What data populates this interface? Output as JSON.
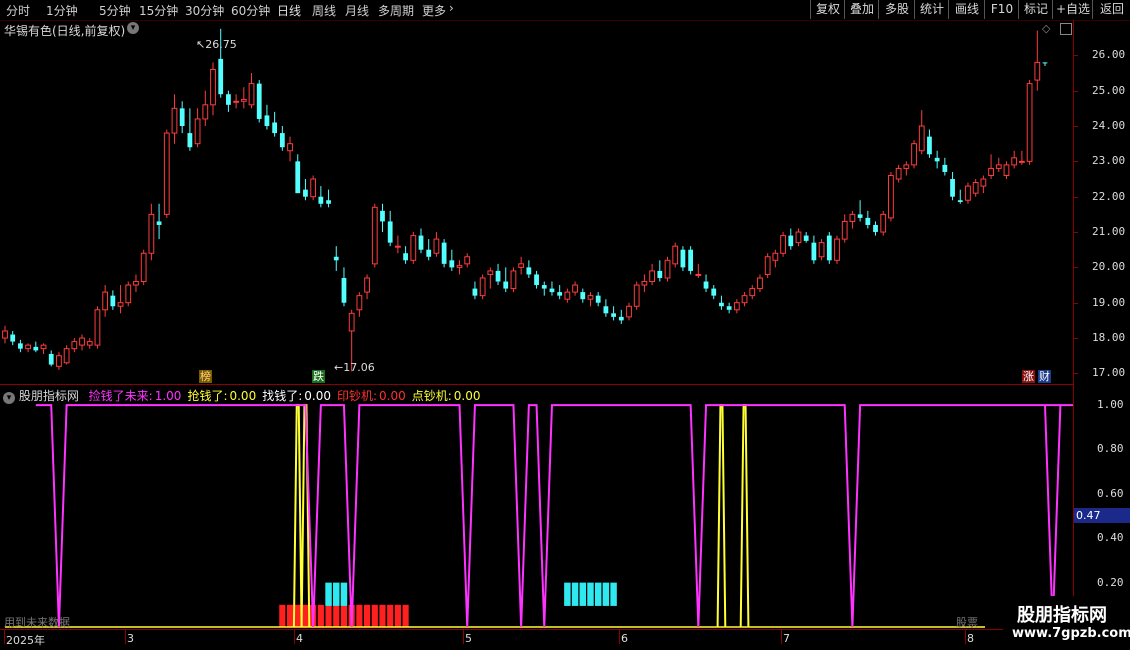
{
  "toolbar": {
    "periods": [
      "分时",
      "1分钟",
      "5分钟",
      "15分钟",
      "30分钟",
      "60分钟",
      "日线",
      "周线",
      "月线",
      "多周期",
      "更多"
    ],
    "more_icon": "chevron-right-icon",
    "right_tabs": [
      "复权",
      "叠加",
      "多股",
      "统计",
      "画线",
      "F10",
      "标记",
      "+自选",
      "返回"
    ]
  },
  "stock_title": "华锡有色(日线,前复权)",
  "stock_title_icon": "chevron-down-circle-icon",
  "price_annotations": {
    "high": "26.75",
    "low": "17.06"
  },
  "price_axis": [
    "26.00",
    "25.00",
    "24.00",
    "23.00",
    "22.00",
    "21.00",
    "20.00",
    "19.00",
    "18.00",
    "17.00"
  ],
  "top_badges": {
    "bang": "榜",
    "die": "跌",
    "zhang": "涨",
    "cai": "财"
  },
  "indicator": {
    "name": "股朋指标网",
    "items": [
      {
        "label": "捡钱了未来:",
        "value": "1.00",
        "color": "#ff33ff"
      },
      {
        "label": "抢钱了:",
        "value": "0.00",
        "color": "#ffff33"
      },
      {
        "label": "找钱了:",
        "value": "0.00",
        "color": "#ffffff"
      },
      {
        "label": "印钞机:",
        "value": "0.00",
        "color": "#ff3030"
      },
      {
        "label": "点钞机:",
        "value": "0.00",
        "color": "#ffff33"
      }
    ],
    "axis": [
      "1.00",
      "0.80",
      "0.60",
      "0.40",
      "0.20"
    ],
    "current": "0.47",
    "bottom_left_note": "用到未来数据",
    "bottom_right_note": "股票"
  },
  "x_axis": [
    "2025年",
    "3",
    "4",
    "5",
    "6",
    "7",
    "8"
  ],
  "watermark": {
    "title": "股朋指标网",
    "url": "www.7gpzb.com"
  },
  "colors": {
    "up": "#ff3c3c",
    "down": "#54ffff",
    "grid": "#8b0000",
    "magenta": "#ff33ff",
    "yellow": "#ffff33"
  },
  "chart_data": [
    {
      "type": "candlestick",
      "title": "华锡有色(日线,前复权)",
      "ylim": [
        16.7,
        27.0
      ],
      "max_label": 26.75,
      "min_label": 17.06,
      "ohlc": [
        [
          18.0,
          18.35,
          17.85,
          18.2
        ],
        [
          18.1,
          18.2,
          17.8,
          17.9
        ],
        [
          17.85,
          17.95,
          17.6,
          17.7
        ],
        [
          17.7,
          17.85,
          17.6,
          17.8
        ],
        [
          17.75,
          17.9,
          17.6,
          17.65
        ],
        [
          17.7,
          17.85,
          17.55,
          17.8
        ],
        [
          17.55,
          17.65,
          17.2,
          17.25
        ],
        [
          17.2,
          17.6,
          17.1,
          17.5
        ],
        [
          17.3,
          17.8,
          17.25,
          17.7
        ],
        [
          17.7,
          18.0,
          17.6,
          17.9
        ],
        [
          17.8,
          18.1,
          17.65,
          18.0
        ],
        [
          17.8,
          18.0,
          17.7,
          17.9
        ],
        [
          17.8,
          18.9,
          17.7,
          18.8
        ],
        [
          18.8,
          19.5,
          18.6,
          19.3
        ],
        [
          19.2,
          19.35,
          18.8,
          18.9
        ],
        [
          18.9,
          19.5,
          18.7,
          19.0
        ],
        [
          19.0,
          19.6,
          18.9,
          19.5
        ],
        [
          19.5,
          19.8,
          19.3,
          19.6
        ],
        [
          19.6,
          20.5,
          19.5,
          20.4
        ],
        [
          20.4,
          21.8,
          20.2,
          21.5
        ],
        [
          21.3,
          21.8,
          20.8,
          21.2
        ],
        [
          21.5,
          23.9,
          21.4,
          23.8
        ],
        [
          23.8,
          24.9,
          23.5,
          24.5
        ],
        [
          24.5,
          24.7,
          23.8,
          24.0
        ],
        [
          23.8,
          24.5,
          23.3,
          23.4
        ],
        [
          23.5,
          24.5,
          23.4,
          24.2
        ],
        [
          24.2,
          25.0,
          24.0,
          24.6
        ],
        [
          24.6,
          25.8,
          24.3,
          25.6
        ],
        [
          25.9,
          26.75,
          24.8,
          24.9
        ],
        [
          24.9,
          25.0,
          24.4,
          24.6
        ],
        [
          24.7,
          24.9,
          24.5,
          24.7
        ],
        [
          24.7,
          25.1,
          24.5,
          24.75
        ],
        [
          24.6,
          25.5,
          24.5,
          25.2
        ],
        [
          25.2,
          25.3,
          24.1,
          24.2
        ],
        [
          24.3,
          24.6,
          23.9,
          24.0
        ],
        [
          24.1,
          24.4,
          23.7,
          23.8
        ],
        [
          23.8,
          24.0,
          23.3,
          23.4
        ],
        [
          23.3,
          23.7,
          23.0,
          23.5
        ],
        [
          23.0,
          23.2,
          22.1,
          22.1
        ],
        [
          22.2,
          22.5,
          21.9,
          22.0
        ],
        [
          22.0,
          22.6,
          21.9,
          22.5
        ],
        [
          22.0,
          22.3,
          21.7,
          21.8
        ],
        [
          21.9,
          22.2,
          21.7,
          21.8
        ],
        [
          20.3,
          20.6,
          19.9,
          20.2
        ],
        [
          19.7,
          20.0,
          18.9,
          19.0
        ],
        [
          18.2,
          18.8,
          17.06,
          18.7
        ],
        [
          18.8,
          19.3,
          18.6,
          19.2
        ],
        [
          19.3,
          19.8,
          19.1,
          19.7
        ],
        [
          20.1,
          21.8,
          20.0,
          21.7
        ],
        [
          21.6,
          21.8,
          21.0,
          21.3
        ],
        [
          21.3,
          21.6,
          20.6,
          20.7
        ],
        [
          20.6,
          20.9,
          20.4,
          20.6
        ],
        [
          20.4,
          20.6,
          20.1,
          20.2
        ],
        [
          20.2,
          21.0,
          20.1,
          20.9
        ],
        [
          20.9,
          21.1,
          20.4,
          20.5
        ],
        [
          20.5,
          20.8,
          20.2,
          20.3
        ],
        [
          20.4,
          21.0,
          20.3,
          20.8
        ],
        [
          20.7,
          20.8,
          20.0,
          20.1
        ],
        [
          20.2,
          20.5,
          19.9,
          20.0
        ],
        [
          20.0,
          20.2,
          19.8,
          20.05
        ],
        [
          20.1,
          20.4,
          20.0,
          20.3
        ],
        [
          19.4,
          19.6,
          19.1,
          19.2
        ],
        [
          19.2,
          19.8,
          19.1,
          19.7
        ],
        [
          19.8,
          20.0,
          19.4,
          19.9
        ],
        [
          19.9,
          20.1,
          19.5,
          19.6
        ],
        [
          19.6,
          20.0,
          19.3,
          19.4
        ],
        [
          19.4,
          20.0,
          19.3,
          19.9
        ],
        [
          20.0,
          20.3,
          19.8,
          20.1
        ],
        [
          20.0,
          20.2,
          19.7,
          19.8
        ],
        [
          19.8,
          19.9,
          19.4,
          19.5
        ],
        [
          19.5,
          19.6,
          19.2,
          19.4
        ],
        [
          19.4,
          19.6,
          19.2,
          19.3
        ],
        [
          19.3,
          19.5,
          19.1,
          19.2
        ],
        [
          19.1,
          19.4,
          19.0,
          19.3
        ],
        [
          19.3,
          19.6,
          19.2,
          19.5
        ],
        [
          19.3,
          19.4,
          19.0,
          19.1
        ],
        [
          19.1,
          19.3,
          18.9,
          19.2
        ],
        [
          19.2,
          19.3,
          18.9,
          19.0
        ],
        [
          18.9,
          19.1,
          18.6,
          18.7
        ],
        [
          18.7,
          18.9,
          18.5,
          18.6
        ],
        [
          18.6,
          18.8,
          18.4,
          18.5
        ],
        [
          18.6,
          19.0,
          18.5,
          18.9
        ],
        [
          18.9,
          19.6,
          18.8,
          19.5
        ],
        [
          19.5,
          19.8,
          19.3,
          19.6
        ],
        [
          19.6,
          20.1,
          19.5,
          19.9
        ],
        [
          19.9,
          20.2,
          19.6,
          19.7
        ],
        [
          19.7,
          20.3,
          19.6,
          20.2
        ],
        [
          20.1,
          20.7,
          20.0,
          20.6
        ],
        [
          20.5,
          20.6,
          19.9,
          20.0
        ],
        [
          20.5,
          20.6,
          19.8,
          19.9
        ],
        [
          19.8,
          20.1,
          19.7,
          19.8
        ],
        [
          19.6,
          19.8,
          19.3,
          19.4
        ],
        [
          19.4,
          19.5,
          19.1,
          19.2
        ],
        [
          19.0,
          19.2,
          18.8,
          18.9
        ],
        [
          18.9,
          19.0,
          18.7,
          18.8
        ],
        [
          18.8,
          19.1,
          18.7,
          19.0
        ],
        [
          19.0,
          19.3,
          18.9,
          19.2
        ],
        [
          19.2,
          19.5,
          19.1,
          19.4
        ],
        [
          19.4,
          19.8,
          19.3,
          19.7
        ],
        [
          19.8,
          20.4,
          19.7,
          20.3
        ],
        [
          20.2,
          20.5,
          20.0,
          20.4
        ],
        [
          20.4,
          21.0,
          20.3,
          20.9
        ],
        [
          20.9,
          21.1,
          20.5,
          20.6
        ],
        [
          20.7,
          21.1,
          20.6,
          21.0
        ],
        [
          20.9,
          21.0,
          20.7,
          20.75
        ],
        [
          20.7,
          20.9,
          20.1,
          20.2
        ],
        [
          20.3,
          20.8,
          20.2,
          20.7
        ],
        [
          20.9,
          21.0,
          20.1,
          20.2
        ],
        [
          20.2,
          20.9,
          20.1,
          20.8
        ],
        [
          20.8,
          21.5,
          20.7,
          21.3
        ],
        [
          21.3,
          21.6,
          21.1,
          21.5
        ],
        [
          21.5,
          21.9,
          21.3,
          21.4
        ],
        [
          21.4,
          21.6,
          21.1,
          21.2
        ],
        [
          21.2,
          21.3,
          20.9,
          21.0
        ],
        [
          21.0,
          21.6,
          20.9,
          21.5
        ],
        [
          21.4,
          22.7,
          21.3,
          22.6
        ],
        [
          22.5,
          22.9,
          22.4,
          22.8
        ],
        [
          22.8,
          23.0,
          22.6,
          22.9
        ],
        [
          22.9,
          23.6,
          22.8,
          23.5
        ],
        [
          23.3,
          24.45,
          23.2,
          24.0
        ],
        [
          23.7,
          23.9,
          23.1,
          23.2
        ],
        [
          23.1,
          23.3,
          22.8,
          23.0
        ],
        [
          22.9,
          23.1,
          22.6,
          22.7
        ],
        [
          22.5,
          22.7,
          21.9,
          22.0
        ],
        [
          21.9,
          22.2,
          21.8,
          21.85
        ],
        [
          21.9,
          22.4,
          21.8,
          22.3
        ],
        [
          22.1,
          22.5,
          22.0,
          22.4
        ],
        [
          22.3,
          22.6,
          22.1,
          22.5
        ],
        [
          22.6,
          23.2,
          22.5,
          22.8
        ],
        [
          22.8,
          23.1,
          22.7,
          22.9
        ],
        [
          22.6,
          23.0,
          22.5,
          22.9
        ],
        [
          22.9,
          23.3,
          22.8,
          23.1
        ],
        [
          23.0,
          23.3,
          22.9,
          23.0
        ],
        [
          23.0,
          25.3,
          22.9,
          25.2
        ],
        [
          25.3,
          26.7,
          25.0,
          25.8
        ],
        [
          25.8,
          25.8,
          25.7,
          25.78
        ]
      ]
    },
    {
      "type": "line",
      "title": "股朋指标网",
      "ylim": [
        0,
        1.05
      ],
      "series": [
        {
          "name": "捡钱了未来",
          "color": "#ff33ff",
          "dips": [
            7,
            40,
            45,
            60,
            67,
            70,
            90,
            110,
            136,
            155
          ]
        },
        {
          "name": "抢钱了",
          "color": "#ffff33",
          "spikes": [
            38,
            93
          ]
        },
        {
          "name": "点钞机",
          "color": "#ffff33",
          "spikes": [
            39,
            96
          ]
        }
      ],
      "red_bars_range": [
        36,
        52
      ],
      "cyan_bars_range": [
        [
          42,
          44
        ],
        [
          73,
          79
        ]
      ]
    }
  ]
}
